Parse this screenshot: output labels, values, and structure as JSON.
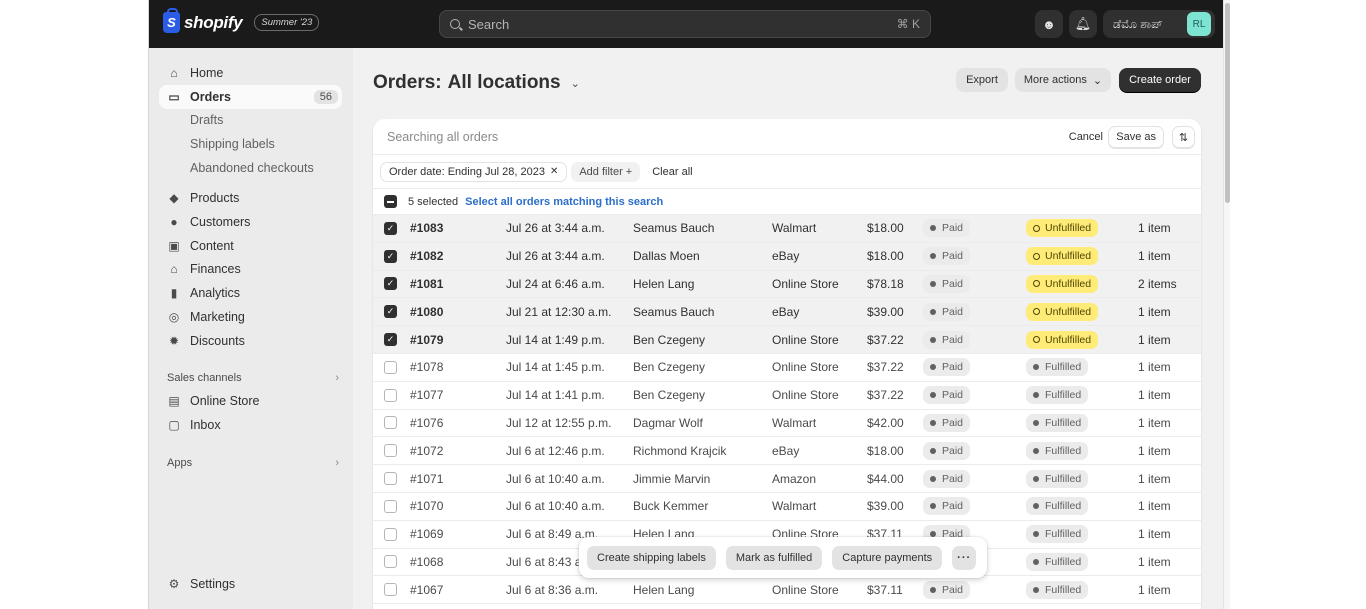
{
  "topbar": {
    "brand": "shopify",
    "edition": "Summer '23",
    "search_placeholder": "Search",
    "search_shortcut": "⌘ K",
    "store_name": "ಡೆಮೊ ಶಾಪ್",
    "avatar_initials": "RL"
  },
  "sidebar": {
    "items": [
      {
        "label": "Home",
        "icon": "home-icon"
      },
      {
        "label": "Orders",
        "icon": "inbox-icon",
        "badge": "56",
        "active": true
      },
      {
        "label": "Drafts",
        "sub": true
      },
      {
        "label": "Shipping labels",
        "sub": true
      },
      {
        "label": "Abandoned checkouts",
        "sub": true
      },
      {
        "label": "Products",
        "icon": "tag-icon"
      },
      {
        "label": "Customers",
        "icon": "person-icon"
      },
      {
        "label": "Content",
        "icon": "content-icon"
      },
      {
        "label": "Finances",
        "icon": "bank-icon"
      },
      {
        "label": "Analytics",
        "icon": "bar-chart-icon"
      },
      {
        "label": "Marketing",
        "icon": "target-icon"
      },
      {
        "label": "Discounts",
        "icon": "discount-icon"
      }
    ],
    "sales_channels_label": "Sales channels",
    "channels": [
      {
        "label": "Online Store",
        "icon": "store-icon"
      },
      {
        "label": "Inbox",
        "icon": "inbox-chat-icon"
      }
    ],
    "apps_label": "Apps",
    "settings_label": "Settings"
  },
  "page": {
    "title_prefix": "Orders:",
    "location": "All locations",
    "export_label": "Export",
    "more_actions_label": "More actions",
    "create_order_label": "Create order"
  },
  "card": {
    "search_text": "Searching all orders",
    "cancel_label": "Cancel",
    "save_as_label": "Save as",
    "filter_chip": "Order date: Ending Jul 28, 2023",
    "add_filter_label": "Add filter +",
    "clear_all_label": "Clear all",
    "selected_count": "5 selected",
    "select_all_label": "Select all orders matching this search"
  },
  "orders": [
    {
      "id": "#1083",
      "date": "Jul 26 at 3:44 a.m.",
      "customer": "Seamus Bauch",
      "channel": "Walmart",
      "total": "$18.00",
      "payment": "Paid",
      "fulfillment": "Unfulfilled",
      "items": "1 item",
      "selected": true
    },
    {
      "id": "#1082",
      "date": "Jul 26 at 3:44 a.m.",
      "customer": "Dallas Moen",
      "channel": "eBay",
      "total": "$18.00",
      "payment": "Paid",
      "fulfillment": "Unfulfilled",
      "items": "1 item",
      "selected": true
    },
    {
      "id": "#1081",
      "date": "Jul 24 at 6:46 a.m.",
      "customer": "Helen Lang",
      "channel": "Online Store",
      "total": "$78.18",
      "payment": "Paid",
      "fulfillment": "Unfulfilled",
      "items": "2 items",
      "selected": true
    },
    {
      "id": "#1080",
      "date": "Jul 21 at 12:30 a.m.",
      "customer": "Seamus Bauch",
      "channel": "eBay",
      "total": "$39.00",
      "payment": "Paid",
      "fulfillment": "Unfulfilled",
      "items": "1 item",
      "selected": true
    },
    {
      "id": "#1079",
      "date": "Jul 14 at 1:49 p.m.",
      "customer": "Ben Czegeny",
      "channel": "Online Store",
      "total": "$37.22",
      "payment": "Paid",
      "fulfillment": "Unfulfilled",
      "items": "1 item",
      "selected": true
    },
    {
      "id": "#1078",
      "date": "Jul 14 at 1:45 p.m.",
      "customer": "Ben Czegeny",
      "channel": "Online Store",
      "total": "$37.22",
      "payment": "Paid",
      "fulfillment": "Fulfilled",
      "items": "1 item",
      "selected": false
    },
    {
      "id": "#1077",
      "date": "Jul 14 at 1:41 p.m.",
      "customer": "Ben Czegeny",
      "channel": "Online Store",
      "total": "$37.22",
      "payment": "Paid",
      "fulfillment": "Fulfilled",
      "items": "1 item",
      "selected": false
    },
    {
      "id": "#1076",
      "date": "Jul 12 at 12:55 p.m.",
      "customer": "Dagmar Wolf",
      "channel": "Walmart",
      "total": "$42.00",
      "payment": "Paid",
      "fulfillment": "Fulfilled",
      "items": "1 item",
      "selected": false
    },
    {
      "id": "#1072",
      "date": "Jul 6 at 12:46 p.m.",
      "customer": "Richmond Krajcik",
      "channel": "eBay",
      "total": "$18.00",
      "payment": "Paid",
      "fulfillment": "Fulfilled",
      "items": "1 item",
      "selected": false
    },
    {
      "id": "#1071",
      "date": "Jul 6 at 10:40 a.m.",
      "customer": "Jimmie Marvin",
      "channel": "Amazon",
      "total": "$44.00",
      "payment": "Paid",
      "fulfillment": "Fulfilled",
      "items": "1 item",
      "selected": false
    },
    {
      "id": "#1070",
      "date": "Jul 6 at 10:40 a.m.",
      "customer": "Buck Kemmer",
      "channel": "Walmart",
      "total": "$39.00",
      "payment": "Paid",
      "fulfillment": "Fulfilled",
      "items": "1 item",
      "selected": false
    },
    {
      "id": "#1069",
      "date": "Jul 6 at 8:49 a.m.",
      "customer": "Helen Lang",
      "channel": "Online Store",
      "total": "$37.11",
      "payment": "Paid",
      "fulfillment": "Fulfilled",
      "items": "1 item",
      "selected": false
    },
    {
      "id": "#1068",
      "date": "Jul 6 at 8:43 a.m.",
      "customer": "",
      "channel": "",
      "total": "",
      "payment": "",
      "fulfillment": "Fulfilled",
      "items": "1 item",
      "selected": false
    },
    {
      "id": "#1067",
      "date": "Jul 6 at 8:36 a.m.",
      "customer": "Helen Lang",
      "channel": "Online Store",
      "total": "$37.11",
      "payment": "Paid",
      "fulfillment": "Fulfilled",
      "items": "1 item",
      "selected": false
    }
  ],
  "bulk_actions": {
    "create_shipping_labels": "Create shipping labels",
    "mark_as_fulfilled": "Mark as fulfilled",
    "capture_payments": "Capture payments",
    "more": "···"
  },
  "colors": {
    "topbar_bg": "#1a1a1a",
    "primary_button": "#303030",
    "unfulfilled_badge": "#ffeb78",
    "link": "#2c6ecb",
    "avatar_bg": "#7de4d2"
  }
}
